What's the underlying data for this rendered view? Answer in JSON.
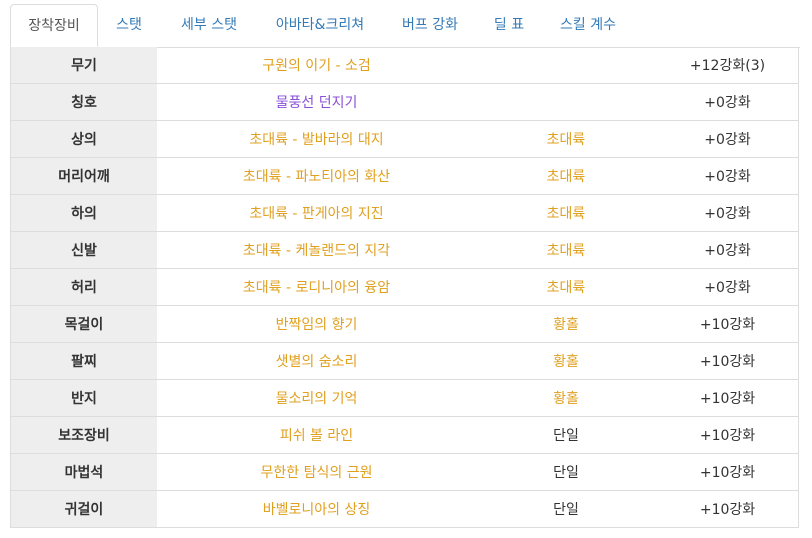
{
  "tabs": [
    {
      "label": "장착장비",
      "active": true
    },
    {
      "label": "스탯",
      "active": false
    },
    {
      "label": "세부 스탯",
      "active": false
    },
    {
      "label": "아바타&크리쳐",
      "active": false
    },
    {
      "label": "버프 강화",
      "active": false
    },
    {
      "label": "딜 표",
      "active": false
    },
    {
      "label": "스킬 계수",
      "active": false
    }
  ],
  "colors": {
    "gold": "#e0a020",
    "purple": "#8a4fd8",
    "label_bg": "#eeeeee",
    "tab_link": "#337ab7"
  },
  "equipment": [
    {
      "slot": "무기",
      "name": "구원의 이기 - 소검",
      "name_color": "gold",
      "set": "",
      "set_color": "plain",
      "enhance": "+12강화(3)"
    },
    {
      "slot": "칭호",
      "name": "물풍선 던지기",
      "name_color": "purple",
      "set": "",
      "set_color": "plain",
      "enhance": "+0강화"
    },
    {
      "slot": "상의",
      "name": "초대륙 - 발바라의 대지",
      "name_color": "gold",
      "set": "초대륙",
      "set_color": "gold",
      "enhance": "+0강화"
    },
    {
      "slot": "머리어깨",
      "name": "초대륙 - 파노티아의 화산",
      "name_color": "gold",
      "set": "초대륙",
      "set_color": "gold",
      "enhance": "+0강화"
    },
    {
      "slot": "하의",
      "name": "초대륙 - 판게아의 지진",
      "name_color": "gold",
      "set": "초대륙",
      "set_color": "gold",
      "enhance": "+0강화"
    },
    {
      "slot": "신발",
      "name": "초대륙 - 케놀랜드의 지각",
      "name_color": "gold",
      "set": "초대륙",
      "set_color": "gold",
      "enhance": "+0강화"
    },
    {
      "slot": "허리",
      "name": "초대륙 - 로디니아의 융암",
      "name_color": "gold",
      "set": "초대륙",
      "set_color": "gold",
      "enhance": "+0강화"
    },
    {
      "slot": "목걸이",
      "name": "반짝임의 향기",
      "name_color": "gold",
      "set": "황홀",
      "set_color": "gold",
      "enhance": "+10강화"
    },
    {
      "slot": "팔찌",
      "name": "샛별의 숨소리",
      "name_color": "gold",
      "set": "황홀",
      "set_color": "gold",
      "enhance": "+10강화"
    },
    {
      "slot": "반지",
      "name": "물소리의 기억",
      "name_color": "gold",
      "set": "황홀",
      "set_color": "gold",
      "enhance": "+10강화"
    },
    {
      "slot": "보조장비",
      "name": "피쉬 볼 라인",
      "name_color": "gold",
      "set": "단일",
      "set_color": "plain",
      "enhance": "+10강화"
    },
    {
      "slot": "마법석",
      "name": "무한한 탐식의 근원",
      "name_color": "gold",
      "set": "단일",
      "set_color": "plain",
      "enhance": "+10강화"
    },
    {
      "slot": "귀걸이",
      "name": "바벨로니아의 상징",
      "name_color": "gold",
      "set": "단일",
      "set_color": "plain",
      "enhance": "+10강화"
    }
  ]
}
